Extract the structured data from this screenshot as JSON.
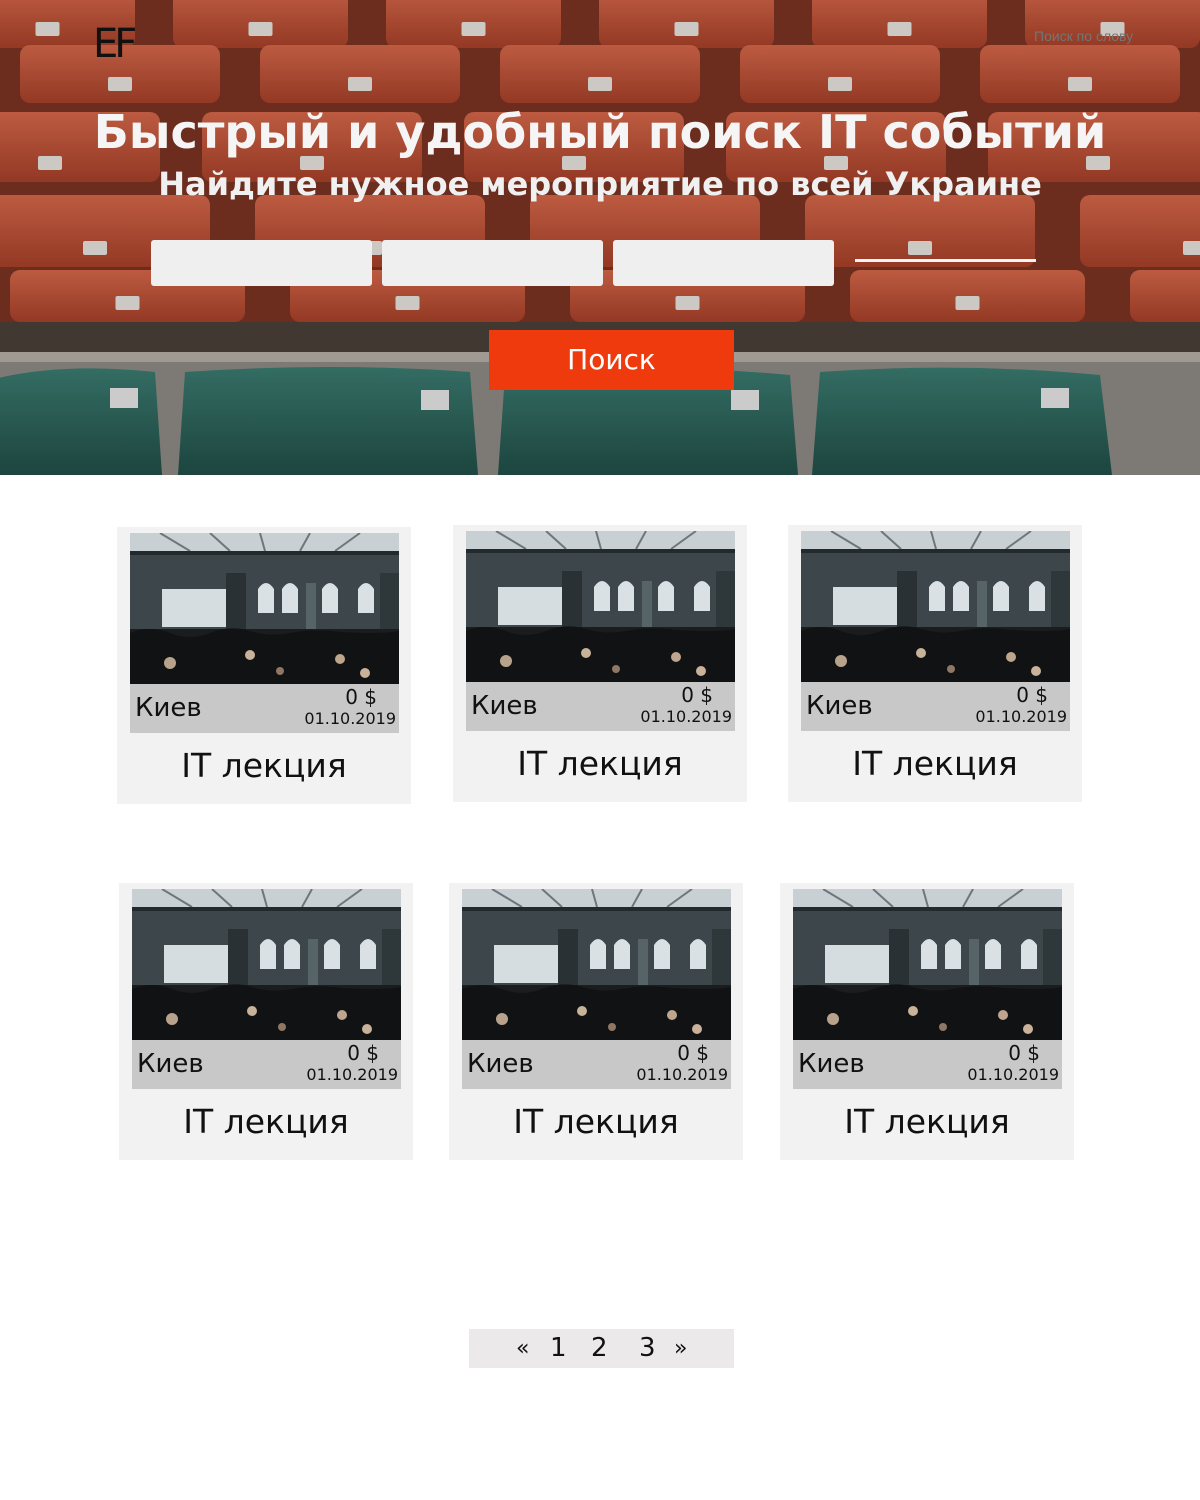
{
  "header": {
    "logo": "EF",
    "word_search_placeholder": "Поиск по слову"
  },
  "hero": {
    "title": "Быстрый и удобный поиск IT событий",
    "subtitle": "Найдите нужное мероприятие по всей Украине",
    "filters": [
      "",
      "",
      ""
    ],
    "search_button": "Поиск"
  },
  "events": [
    {
      "city": "Киев",
      "price": "0 $",
      "date": "01.10.2019",
      "title": "IT лекция"
    },
    {
      "city": "Киев",
      "price": "0 $",
      "date": "01.10.2019",
      "title": "IT лекция"
    },
    {
      "city": "Киев",
      "price": "0 $",
      "date": "01.10.2019",
      "title": "IT лекция"
    },
    {
      "city": "Киев",
      "price": "0 $",
      "date": "01.10.2019",
      "title": "IT лекция"
    },
    {
      "city": "Киев",
      "price": "0 $",
      "date": "01.10.2019",
      "title": "IT лекция"
    },
    {
      "city": "Киев",
      "price": "0 $",
      "date": "01.10.2019",
      "title": "IT лекция"
    }
  ],
  "pagination": {
    "prev": "«",
    "pages": [
      "1",
      "2",
      "3"
    ],
    "next": "»"
  },
  "colors": {
    "accent": "#ee3a0c",
    "card_bg": "#f2f2f2",
    "card_info_bg": "#c8c8c8",
    "pagination_bg": "#ebe9e9",
    "seat_orange": "#c9553a",
    "seat_green": "#2e6a60"
  }
}
